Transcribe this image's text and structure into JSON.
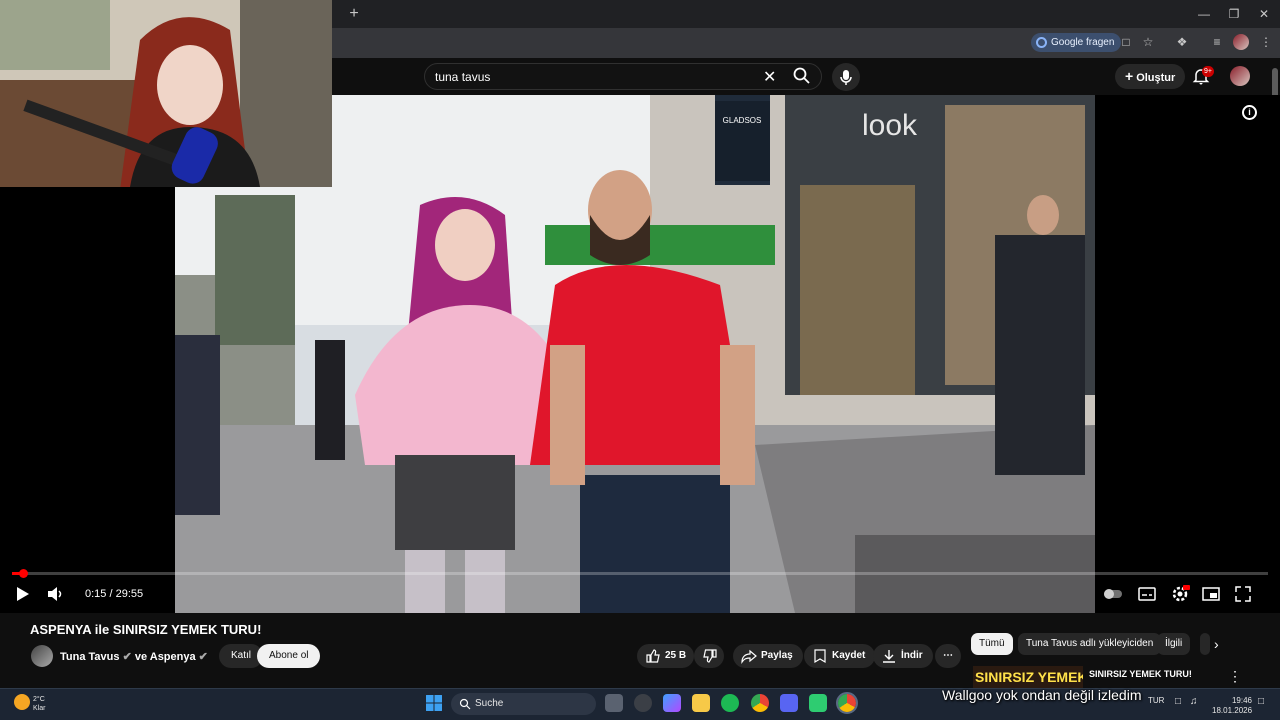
{
  "browser": {
    "google_pill": "Google fragen"
  },
  "youtube": {
    "search": {
      "query": "tuna tavus"
    },
    "create_label": "Oluştur",
    "notifications_badge": "9+"
  },
  "player": {
    "time": "0:15 / 29:55",
    "progress_fraction": 0.0084
  },
  "video": {
    "title": "ASPENYA ile SINIRSIZ YEMEK TURU!",
    "channel": "Tuna Tavus",
    "collab_joiner": "ve",
    "collab_channel": "Aspenya",
    "join_label": "Katıl",
    "subscribe_label": "Abone ol",
    "likes": "25 B",
    "share_label": "Paylaş",
    "save_label": "Kaydet",
    "download_label": "İndir"
  },
  "recommendations": {
    "chips": [
      "Tümü",
      "Tuna Tavus adlı yükleyiciden",
      "İlgili"
    ],
    "first_title": "SINIRSIZ YEMEK TURU!",
    "thumb_text": "SINIRSIZ YEMEK"
  },
  "stream_overlay": {
    "text": "Wallgoo  yok ondan değil izledim"
  },
  "taskbar": {
    "weather_temp": "2°C",
    "weather_state": "Klar",
    "search_label": "Suche",
    "lang": "TUR",
    "time": "19:46",
    "date": "18.01.2026"
  },
  "colors": {
    "accent_red": "#ff0000",
    "yt_bg": "#0f0f0f",
    "chip_bg": "#272727"
  }
}
